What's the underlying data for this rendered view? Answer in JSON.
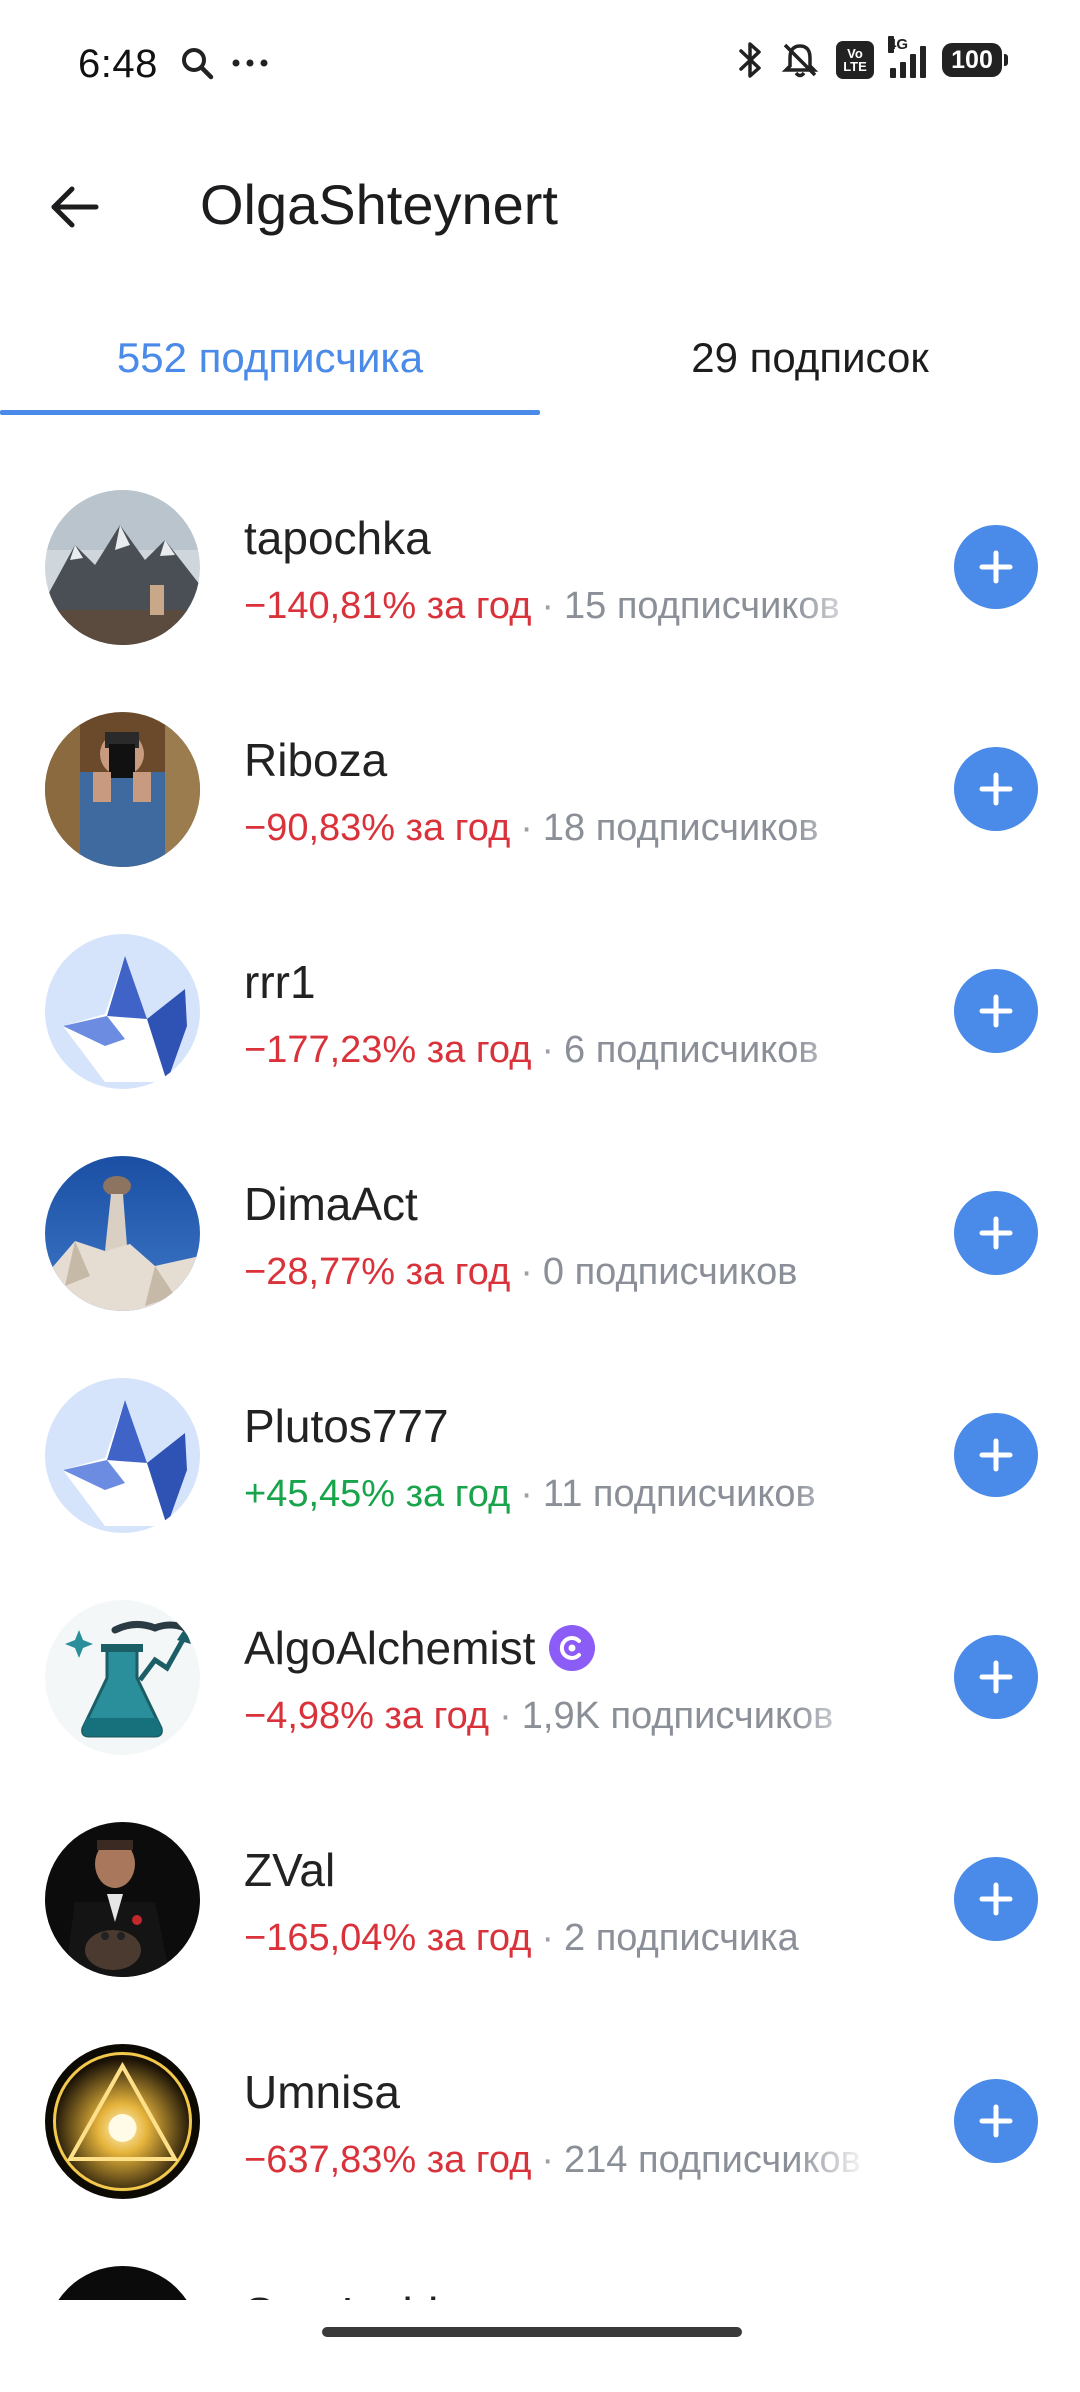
{
  "status_bar": {
    "time": "6:48",
    "network_label": "4G",
    "volte_label_top": "Vo",
    "volte_label_bottom": "LTE",
    "battery_level": "100",
    "icons": [
      "search-icon",
      "more-dots-icon",
      "bluetooth-icon",
      "muted-bell-icon",
      "volte-icon",
      "signal-icon",
      "battery-icon"
    ]
  },
  "header": {
    "title": "OlgaShteynert",
    "back_icon": "arrow-left-icon"
  },
  "tabs": [
    {
      "label": "552 подписчика",
      "active": true
    },
    {
      "label": "29 подписок",
      "active": false
    }
  ],
  "colors": {
    "accent": "#4a8ae8",
    "negative": "#d9323a",
    "positive": "#17a44a",
    "muted": "#8a8f98"
  },
  "users": [
    {
      "name": "tapochka",
      "return": "−140,81% за год",
      "return_sign": "negative",
      "followers": "15 подписчиков"
    },
    {
      "name": "Riboza",
      "return": "−90,83% за год",
      "return_sign": "negative",
      "followers": "18 подписчиков"
    },
    {
      "name": "rrr1",
      "return": "−177,23% за год",
      "return_sign": "negative",
      "followers": "6 подписчиков"
    },
    {
      "name": "DimaAct",
      "return": "−28,77% за год",
      "return_sign": "negative",
      "followers": "0 подписчиков"
    },
    {
      "name": "Plutos777",
      "return": "+45,45% за год",
      "return_sign": "positive",
      "followers": "11 подписчиков"
    },
    {
      "name": "AlgoAlchemist",
      "return": "−4,98% за год",
      "return_sign": "negative",
      "followers": "1,9K подписчиков",
      "badge": "author-badge-icon"
    },
    {
      "name": "ZVal",
      "return": "−165,04% за год",
      "return_sign": "negative",
      "followers": "2 подписчика"
    },
    {
      "name": "Umnisa",
      "return": "−637,83% за год",
      "return_sign": "negative",
      "followers": "214 подписчиков"
    },
    {
      "name": "StartInsider",
      "return": "",
      "return_sign": "negative",
      "followers": ""
    }
  ],
  "separator": "·"
}
